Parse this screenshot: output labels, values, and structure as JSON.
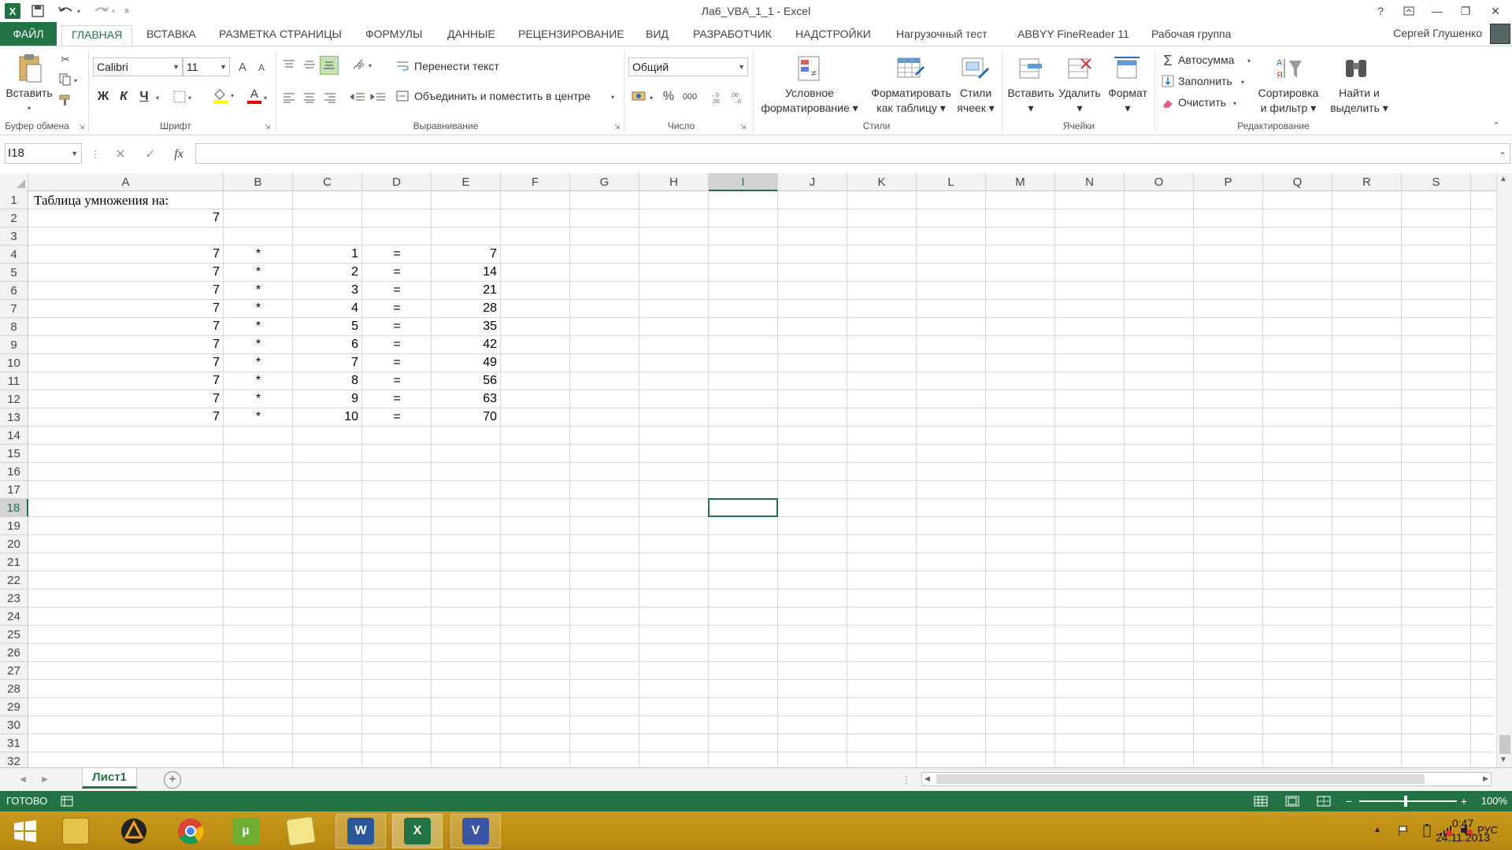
{
  "window": {
    "title": "Ла6_VBA_1_1 - Excel",
    "app_icon": "X",
    "help": "?",
    "minimize": "—",
    "restore": "❐",
    "close": "✕"
  },
  "ribbon_tabs": {
    "file": "ФАЙЛ",
    "items": [
      "ГЛАВНАЯ",
      "ВСТАВКА",
      "РАЗМЕТКА СТРАНИЦЫ",
      "ФОРМУЛЫ",
      "ДАННЫЕ",
      "РЕЦЕНЗИРОВАНИЕ",
      "ВИД",
      "РАЗРАБОТЧИК",
      "НАДСТРОЙКИ",
      "Нагрузочный тест",
      "ABBYY FineReader 11",
      "Рабочая группа"
    ],
    "active": "ГЛАВНАЯ",
    "user": "Сергей Глушенко"
  },
  "ribbon": {
    "clipboard": {
      "paste": "Вставить",
      "label": "Буфер обмена"
    },
    "font": {
      "name": "Calibri",
      "size": "11",
      "bold": "Ж",
      "italic": "К",
      "underline": "Ч",
      "grow": "A",
      "shrink": "A",
      "color": "A",
      "label": "Шрифт"
    },
    "alignment": {
      "wrap": "Перенести текст",
      "merge": "Объединить и поместить в центре",
      "label": "Выравнивание"
    },
    "number": {
      "format": "Общий",
      "percent": "%",
      "thousands": "000",
      "label": "Число"
    },
    "styles": {
      "conditional_1": "Условное",
      "conditional_2": "форматирование",
      "format_table_1": "Форматировать",
      "format_table_2": "как таблицу",
      "cell_styles_1": "Стили",
      "cell_styles_2": "ячеек",
      "label": "Стили"
    },
    "cells": {
      "insert": "Вставить",
      "delete": "Удалить",
      "format": "Формат",
      "label": "Ячейки"
    },
    "editing": {
      "autosum": "Автосумма",
      "fill": "Заполнить",
      "clear": "Очистить",
      "sort_1": "Сортировка",
      "sort_2": "и фильтр",
      "find_1": "Найти и",
      "find_2": "выделить",
      "label": "Редактирование"
    }
  },
  "formula_bar": {
    "name_box": "I18",
    "fx": "fx",
    "cancel": "✕",
    "enter": "✓",
    "value": ""
  },
  "columns": [
    "A",
    "B",
    "C",
    "D",
    "E",
    "F",
    "G",
    "H",
    "I",
    "J",
    "K",
    "L",
    "M",
    "N",
    "O",
    "P",
    "Q",
    "R",
    "S"
  ],
  "selected_column": "I",
  "rows": [
    "1",
    "2",
    "3",
    "4",
    "5",
    "6",
    "7",
    "8",
    "9",
    "10",
    "11",
    "12",
    "13",
    "14",
    "15",
    "16",
    "17",
    "18",
    "19",
    "20",
    "21",
    "22",
    "23",
    "24",
    "25",
    "26",
    "27",
    "28",
    "29",
    "30",
    "31",
    "32"
  ],
  "selected_row": "18",
  "cells": {
    "A1": "Таблица умножения на:",
    "A2": "7",
    "table": [
      {
        "a": "7",
        "b": "*",
        "c": "1",
        "d": "=",
        "e": "7"
      },
      {
        "a": "7",
        "b": "*",
        "c": "2",
        "d": "=",
        "e": "14"
      },
      {
        "a": "7",
        "b": "*",
        "c": "3",
        "d": "=",
        "e": "21"
      },
      {
        "a": "7",
        "b": "*",
        "c": "4",
        "d": "=",
        "e": "28"
      },
      {
        "a": "7",
        "b": "*",
        "c": "5",
        "d": "=",
        "e": "35"
      },
      {
        "a": "7",
        "b": "*",
        "c": "6",
        "d": "=",
        "e": "42"
      },
      {
        "a": "7",
        "b": "*",
        "c": "7",
        "d": "=",
        "e": "49"
      },
      {
        "a": "7",
        "b": "*",
        "c": "8",
        "d": "=",
        "e": "56"
      },
      {
        "a": "7",
        "b": "*",
        "c": "9",
        "d": "=",
        "e": "63"
      },
      {
        "a": "7",
        "b": "*",
        "c": "10",
        "d": "=",
        "e": "70"
      }
    ]
  },
  "sheets": {
    "active": "Лист1",
    "add": "+"
  },
  "status": {
    "mode": "ГОТОВО",
    "zoom": "100%"
  },
  "taskbar": {
    "lang": "РУС",
    "time": "0:47",
    "date": "24.11.2013",
    "apps": [
      {
        "icon": "windows-start-icon",
        "label": ""
      },
      {
        "icon": "file-explorer-icon",
        "label": ""
      },
      {
        "icon": "aimp-icon",
        "label": ""
      },
      {
        "icon": "chrome-icon",
        "label": ""
      },
      {
        "icon": "utorrent-icon",
        "label": ""
      },
      {
        "icon": "sticky-notes-icon",
        "label": ""
      },
      {
        "icon": "word-icon",
        "label": "W"
      },
      {
        "icon": "excel-icon",
        "label": "X"
      },
      {
        "icon": "visio-icon",
        "label": "V"
      }
    ]
  },
  "colors": {
    "accent": "#217346",
    "taskbar": "#c89a1c",
    "selection": "#217346"
  }
}
